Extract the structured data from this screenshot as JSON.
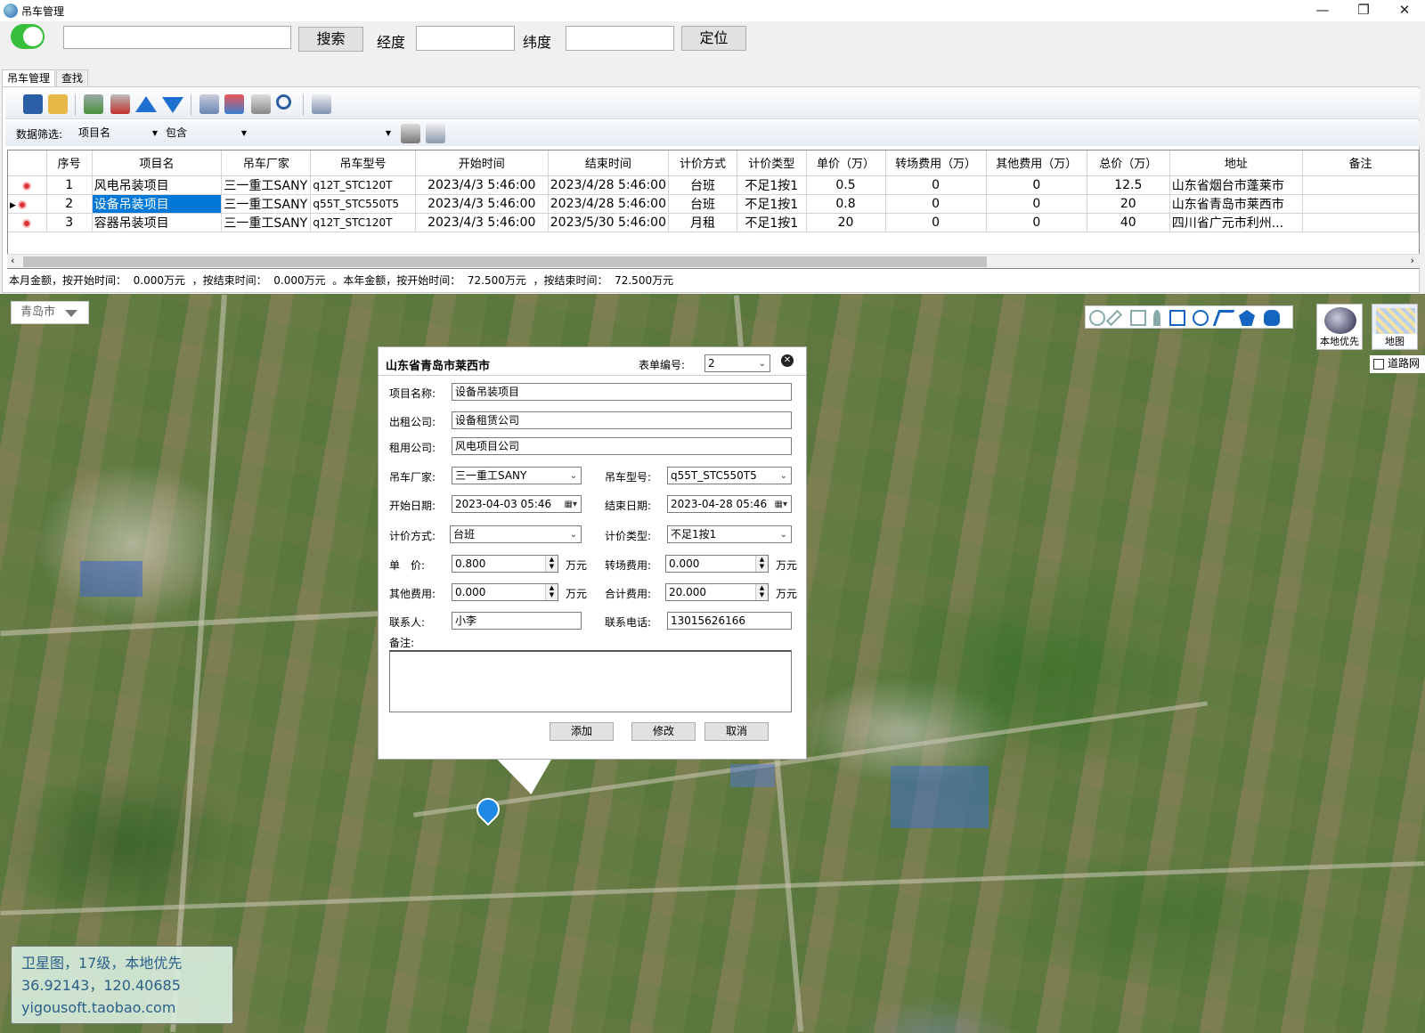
{
  "window": {
    "title": "吊车管理",
    "min": "—",
    "max": "❐",
    "close": "✕"
  },
  "topbar": {
    "search_value": "",
    "search_button": "搜索",
    "lng_label": "经度",
    "lng_value": "",
    "lat_label": "纬度",
    "lat_value": "",
    "locate_button": "定位"
  },
  "tabs": [
    {
      "label": "吊车管理",
      "active": true
    },
    {
      "label": "查找",
      "active": false
    }
  ],
  "toolbar_icons": [
    "save-icon",
    "open-folder-icon",
    "add-record-icon",
    "delete-record-icon",
    "move-up-icon",
    "move-down-icon",
    "import-icon",
    "export-icon",
    "database-icon",
    "search-icon",
    "print-icon"
  ],
  "filter": {
    "label": "数据筛选:",
    "field": "项目名",
    "operator": "包含",
    "value": ""
  },
  "table": {
    "headers": [
      "序号",
      "项目名",
      "吊车厂家",
      "吊车型号",
      "开始时间",
      "结束时间",
      "计价方式",
      "计价类型",
      "单价（万）",
      "转场费用（万）",
      "其他费用（万）",
      "总价（万）",
      "地址",
      "备注"
    ],
    "rows": [
      [
        "1",
        "风电吊装项目",
        "三一重工SANY",
        "q12T_STC120T",
        "2023/4/3 5:46:00",
        "2023/4/28 5:46:00",
        "台班",
        "不足1按1",
        "0.5",
        "0",
        "0",
        "12.5",
        "山东省烟台市蓬莱市",
        ""
      ],
      [
        "2",
        "设备吊装项目",
        "三一重工SANY",
        "q55T_STC550T5",
        "2023/4/3 5:46:00",
        "2023/4/28 5:46:00",
        "台班",
        "不足1按1",
        "0.8",
        "0",
        "0",
        "20",
        "山东省青岛市莱西市",
        ""
      ],
      [
        "3",
        "容器吊装项目",
        "三一重工SANY",
        "q12T_STC120T",
        "2023/4/3 5:46:00",
        "2023/5/30 5:46:00",
        "月租",
        "不足1按1",
        "20",
        "0",
        "0",
        "40",
        "四川省广元市利州...",
        ""
      ]
    ],
    "selected_row": 1
  },
  "summary": "本月金额，按开始时间：  0.000万元  ，按结束时间：  0.000万元  。本年金额，按开始时间：  72.500万元  ，按结束时间：  72.500万元",
  "map": {
    "city": "青岛市",
    "layer_local": "本地优先",
    "layer_map": "地图",
    "roadnet": "道路网",
    "info_lines": [
      "卫星图，17级，本地优先",
      "36.92143，120.40685",
      "yigousoft.taobao.com"
    ],
    "tools": [
      "zoom-icon",
      "measure-icon",
      "edit-icon",
      "pin-icon",
      "rectangle-icon",
      "circle-icon",
      "polyline-icon",
      "polygon-icon",
      "pan-hand-icon"
    ]
  },
  "popup": {
    "title": "山东省青岛市莱西市",
    "form_no_label": "表单编号:",
    "form_no": "2",
    "project_label": "项目名称:",
    "project": "设备吊装项目",
    "lessor_label": "出租公司:",
    "lessor": "设备租赁公司",
    "lessee_label": "租用公司:",
    "lessee": "风电项目公司",
    "maker_label": "吊车厂家:",
    "maker": "三一重工SANY",
    "model_label": "吊车型号:",
    "model": "q55T_STC550T5",
    "start_label": "开始日期:",
    "start": "2023-04-03 05:46",
    "end_label": "结束日期:",
    "end": "2023-04-28 05:46",
    "pricing_label": "计价方式:",
    "pricing": "台班",
    "pricing_type_label": "计价类型:",
    "pricing_type": "不足1按1",
    "unit_price_label": "单　价:",
    "unit_price": "0.800",
    "transfer_label": "转场费用:",
    "transfer": "0.000",
    "other_label": "其他费用:",
    "other": "0.000",
    "total_label": "合计费用:",
    "total": "20.000",
    "unit": "万元",
    "contact_label": "联系人:",
    "contact": "小李",
    "phone_label": "联系电话:",
    "phone": "13015626166",
    "remark_label": "备注:",
    "remark": "",
    "add_button": "添加",
    "modify_button": "修改",
    "cancel_button": "取消"
  }
}
